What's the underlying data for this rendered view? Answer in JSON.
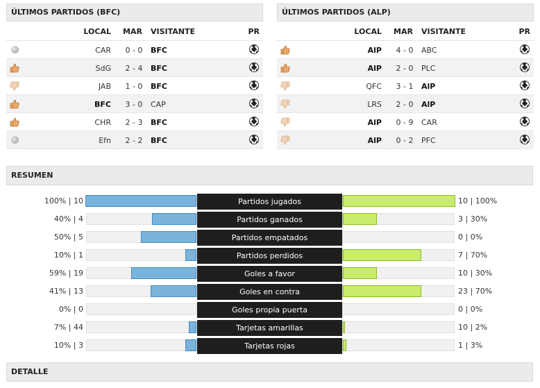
{
  "left_panel": {
    "title": "ÚLTIMOS PARTIDOS (BFC)",
    "headers": {
      "local": "LOCAL",
      "mar": "MAR",
      "visitante": "VISITANTE",
      "pr": "PR"
    },
    "rows": [
      {
        "result": "draw",
        "local": "CAR",
        "score": "0 - 0",
        "visitante": "BFC",
        "bold": "visitante"
      },
      {
        "result": "win",
        "local": "SdG",
        "score": "2 - 4",
        "visitante": "BFC",
        "bold": "visitante"
      },
      {
        "result": "loss",
        "local": "JAB",
        "score": "1 - 0",
        "visitante": "BFC",
        "bold": "visitante"
      },
      {
        "result": "win",
        "local": "BFC",
        "score": "3 - 0",
        "visitante": "CAP",
        "bold": "local"
      },
      {
        "result": "win",
        "local": "CHR",
        "score": "2 - 3",
        "visitante": "BFC",
        "bold": "visitante"
      },
      {
        "result": "draw",
        "local": "Efn",
        "score": "2 - 2",
        "visitante": "BFC",
        "bold": "visitante"
      }
    ]
  },
  "right_panel": {
    "title": "ÚLTIMOS PARTIDOS (ALP)",
    "headers": {
      "local": "LOCAL",
      "mar": "MAR",
      "visitante": "VISITANTE",
      "pr": "PR"
    },
    "rows": [
      {
        "result": "win",
        "local": "AlP",
        "score": "4 - 0",
        "visitante": "ABC",
        "bold": "local"
      },
      {
        "result": "win",
        "local": "AlP",
        "score": "2 - 0",
        "visitante": "PLC",
        "bold": "local"
      },
      {
        "result": "loss",
        "local": "QFC",
        "score": "3 - 1",
        "visitante": "AlP",
        "bold": "visitante"
      },
      {
        "result": "loss",
        "local": "LRS",
        "score": "2 - 0",
        "visitante": "AlP",
        "bold": "visitante"
      },
      {
        "result": "loss",
        "local": "AlP",
        "score": "0 - 9",
        "visitante": "CAR",
        "bold": "local"
      },
      {
        "result": "loss",
        "local": "AlP",
        "score": "0 - 2",
        "visitante": "PFC",
        "bold": "local"
      }
    ]
  },
  "resumen": {
    "title": "RESUMEN",
    "stats": [
      {
        "label": "Partidos jugados",
        "left": "100% | 10",
        "left_pct": 100,
        "right": "10 | 100%",
        "right_pct": 100
      },
      {
        "label": "Partidos ganados",
        "left": "40% | 4",
        "left_pct": 40,
        "right": "3 | 30%",
        "right_pct": 30
      },
      {
        "label": "Partidos empatados",
        "left": "50% | 5",
        "left_pct": 50,
        "right": "0 | 0%",
        "right_pct": 0
      },
      {
        "label": "Partidos perdidos",
        "left": "10% | 1",
        "left_pct": 10,
        "right": "7 | 70%",
        "right_pct": 70
      },
      {
        "label": "Goles a favor",
        "left": "59% | 19",
        "left_pct": 59,
        "right": "10 | 30%",
        "right_pct": 30
      },
      {
        "label": "Goles en contra",
        "left": "41% | 13",
        "left_pct": 41,
        "right": "23 | 70%",
        "right_pct": 70
      },
      {
        "label": "Goles propia puerta",
        "left": "0% | 0",
        "left_pct": 0,
        "right": "0 | 0%",
        "right_pct": 0
      },
      {
        "label": "Tarjetas amarillas",
        "left": "7% | 44",
        "left_pct": 7,
        "right": "10 | 2%",
        "right_pct": 2
      },
      {
        "label": "Tarjetas rojas",
        "left": "10% | 3",
        "left_pct": 10,
        "right": "1 | 3%",
        "right_pct": 3
      }
    ]
  },
  "detalle": {
    "title": "DETALLE"
  },
  "colors": {
    "left_bar": "#7ab4dc",
    "right_bar": "#c9ec6a",
    "label_bg": "#1e1e1e"
  },
  "icons": {
    "draw": "grey-dot-icon",
    "win": "thumbs-up-icon",
    "loss": "thumbs-down-icon",
    "pr": "soccer-ball-icon"
  }
}
